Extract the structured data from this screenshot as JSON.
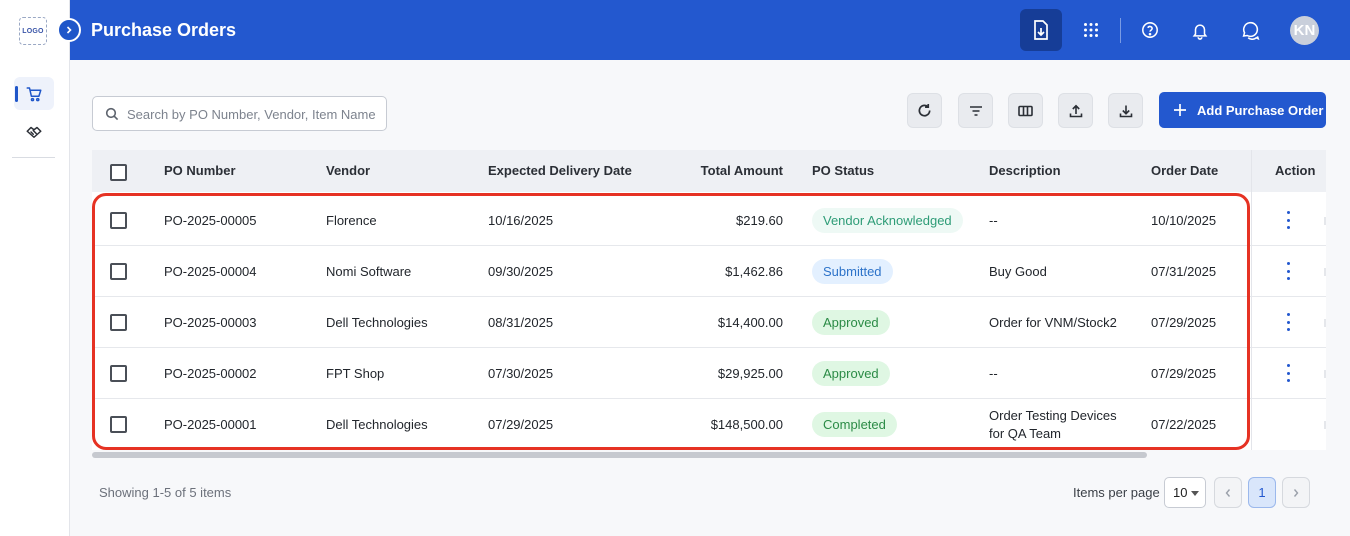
{
  "sidebar": {
    "logo_text": "LOGO",
    "items": [
      {
        "icon": "cart-icon",
        "active": true
      },
      {
        "icon": "handshake-icon",
        "active": false
      }
    ]
  },
  "header": {
    "title": "Purchase Orders",
    "avatar_initials": "KN"
  },
  "toolbar": {
    "search_placeholder": "Search by PO Number, Vendor, Item Name",
    "add_label": "Add Purchase Order"
  },
  "table": {
    "columns": {
      "po_number": "PO Number",
      "vendor": "Vendor",
      "expected_delivery": "Expected Delivery Date",
      "total_amount": "Total Amount",
      "status": "PO Status",
      "description": "Description",
      "order_date": "Order Date",
      "action": "Action"
    },
    "rows": [
      {
        "po": "PO-2025-00005",
        "vendor": "Florence",
        "delivery": "10/16/2025",
        "amount": "$219.60",
        "status": "Vendor Acknowledged",
        "description": "--",
        "description2": "",
        "order_date": "10/10/2025"
      },
      {
        "po": "PO-2025-00004",
        "vendor": "Nomi Software",
        "delivery": "09/30/2025",
        "amount": "$1,462.86",
        "status": "Submitted",
        "description": "Buy Good",
        "description2": "",
        "order_date": "07/31/2025"
      },
      {
        "po": "PO-2025-00003",
        "vendor": "Dell Technologies",
        "delivery": "08/31/2025",
        "amount": "$14,400.00",
        "status": "Approved",
        "description": "Order for VNM/Stock2",
        "description2": "",
        "order_date": "07/29/2025"
      },
      {
        "po": "PO-2025-00002",
        "vendor": "FPT Shop",
        "delivery": "07/30/2025",
        "amount": "$29,925.00",
        "status": "Approved",
        "description": "--",
        "description2": "",
        "order_date": "07/29/2025"
      },
      {
        "po": "PO-2025-00001",
        "vendor": "Dell Technologies",
        "delivery": "07/29/2025",
        "amount": "$148,500.00",
        "status": "Completed",
        "description": "Order Testing Devices",
        "description2": "for QA Team",
        "order_date": "07/22/2025"
      }
    ]
  },
  "footer": {
    "showing": "Showing 1-5 of 5 items",
    "items_per_page_label": "Items per page",
    "items_per_page_value": "10",
    "current_page": "1"
  },
  "colors": {
    "primary": "#2358cf",
    "highlight": "#e63223"
  }
}
